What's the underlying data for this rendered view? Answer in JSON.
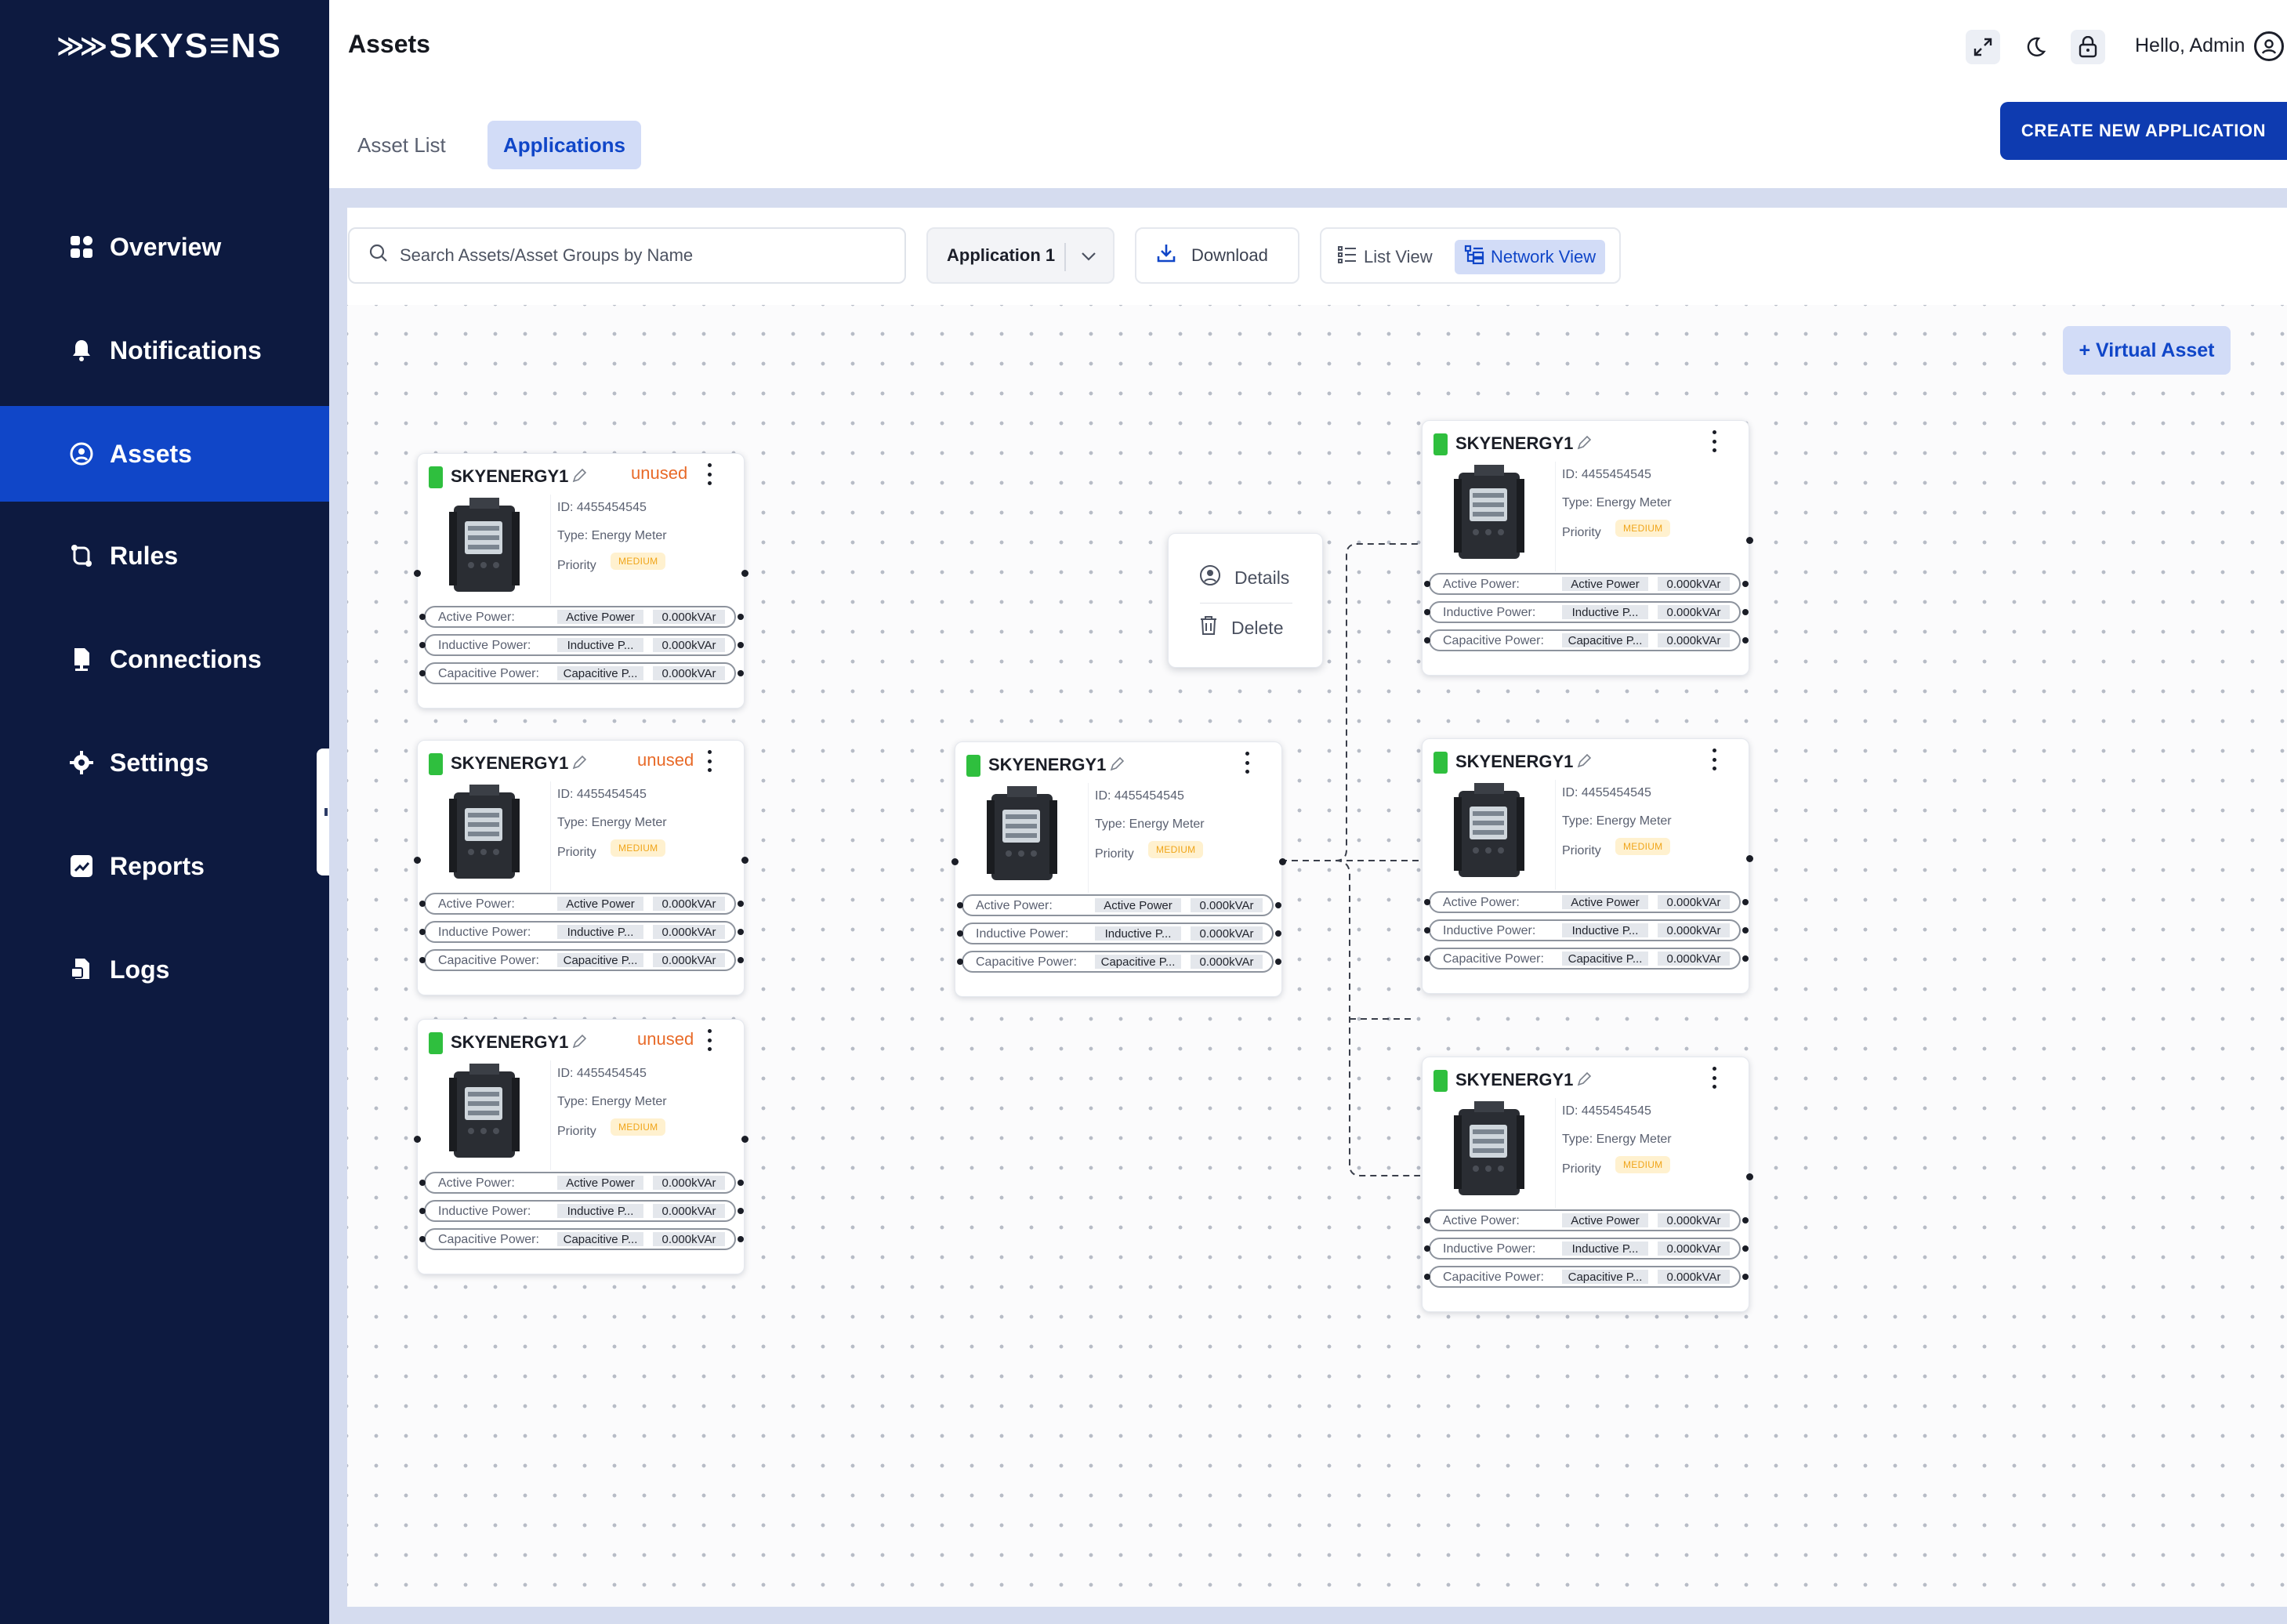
{
  "brand": {
    "name": "SKYS≡NS"
  },
  "sidebar": {
    "items": [
      {
        "label": "Overview"
      },
      {
        "label": "Notifications"
      },
      {
        "label": "Assets"
      },
      {
        "label": "Rules"
      },
      {
        "label": "Connections"
      },
      {
        "label": "Settings"
      },
      {
        "label": "Reports"
      },
      {
        "label": "Logs"
      }
    ],
    "active": "Assets"
  },
  "header": {
    "title": "Assets",
    "greeting": "Hello, Admin"
  },
  "tabs": [
    {
      "label": "Asset List"
    },
    {
      "label": "Applications"
    }
  ],
  "toolbar": {
    "create_label": "CREATE NEW APPLICATION",
    "search_placeholder": "Search Assets/Asset Groups by Name",
    "application_select": "Application 1",
    "download_label": "Download",
    "list_view_label": "List View",
    "network_view_label": "Network View"
  },
  "canvas": {
    "virtual_asset_label": "+ Virtual Asset",
    "context_menu": {
      "details": "Details",
      "delete": "Delete"
    }
  },
  "cards": [
    {
      "name": "SKYENERGY1",
      "unused": "unused",
      "id": "ID: 4455454545",
      "type": "Type: Energy Meter",
      "priority_label": "Priority",
      "priority": "MEDIUM",
      "rows": [
        {
          "label": "Active Power:",
          "chip": "Active Power",
          "value": "0.000kVAr"
        },
        {
          "label": "Inductive Power:",
          "chip": "Inductive P...",
          "value": "0.000kVAr"
        },
        {
          "label": "Capacitive Power:",
          "chip": "Capacitive P...",
          "value": "0.000kVAr"
        }
      ]
    },
    {
      "name": "SKYENERGY1",
      "unused": "unused",
      "id": "ID: 4455454545",
      "type": "Type: Energy Meter",
      "priority_label": "Priority",
      "priority": "MEDIUM",
      "rows": [
        {
          "label": "Active Power:",
          "chip": "Active Power",
          "value": "0.000kVAr"
        },
        {
          "label": "Inductive Power:",
          "chip": "Inductive P...",
          "value": "0.000kVAr"
        },
        {
          "label": "Capacitive Power:",
          "chip": "Capacitive P...",
          "value": "0.000kVAr"
        }
      ]
    },
    {
      "name": "SKYENERGY1",
      "unused": "unused",
      "id": "ID: 4455454545",
      "type": "Type: Energy Meter",
      "priority_label": "Priority",
      "priority": "MEDIUM",
      "rows": [
        {
          "label": "Active Power:",
          "chip": "Active Power",
          "value": "0.000kVAr"
        },
        {
          "label": "Inductive Power:",
          "chip": "Inductive P...",
          "value": "0.000kVAr"
        },
        {
          "label": "Capacitive Power:",
          "chip": "Capacitive P...",
          "value": "0.000kVAr"
        }
      ]
    },
    {
      "name": "SKYENERGY1",
      "unused": "",
      "id": "ID: 4455454545",
      "type": "Type: Energy Meter",
      "priority_label": "Priority",
      "priority": "MEDIUM",
      "rows": [
        {
          "label": "Active Power:",
          "chip": "Active Power",
          "value": "0.000kVAr"
        },
        {
          "label": "Inductive Power:",
          "chip": "Inductive P...",
          "value": "0.000kVAr"
        },
        {
          "label": "Capacitive Power:",
          "chip": "Capacitive P...",
          "value": "0.000kVAr"
        }
      ]
    },
    {
      "name": "SKYENERGY1",
      "unused": "",
      "id": "ID: 4455454545",
      "type": "Type: Energy Meter",
      "priority_label": "Priority",
      "priority": "MEDIUM",
      "rows": [
        {
          "label": "Active Power:",
          "chip": "Active Power",
          "value": "0.000kVAr"
        },
        {
          "label": "Inductive Power:",
          "chip": "Inductive P...",
          "value": "0.000kVAr"
        },
        {
          "label": "Capacitive Power:",
          "chip": "Capacitive P...",
          "value": "0.000kVAr"
        }
      ]
    },
    {
      "name": "SKYENERGY1",
      "unused": "",
      "id": "ID: 4455454545",
      "type": "Type: Energy Meter",
      "priority_label": "Priority",
      "priority": "MEDIUM",
      "rows": [
        {
          "label": "Active Power:",
          "chip": "Active Power",
          "value": "0.000kVAr"
        },
        {
          "label": "Inductive Power:",
          "chip": "Inductive P...",
          "value": "0.000kVAr"
        },
        {
          "label": "Capacitive Power:",
          "chip": "Capacitive P...",
          "value": "0.000kVAr"
        }
      ]
    },
    {
      "name": "SKYENERGY1",
      "unused": "",
      "id": "ID: 4455454545",
      "type": "Type: Energy Meter",
      "priority_label": "Priority",
      "priority": "MEDIUM",
      "rows": [
        {
          "label": "Active Power:",
          "chip": "Active Power",
          "value": "0.000kVAr"
        },
        {
          "label": "Inductive Power:",
          "chip": "Inductive P...",
          "value": "0.000kVAr"
        },
        {
          "label": "Capacitive Power:",
          "chip": "Capacitive P...",
          "value": "0.000kVAr"
        }
      ]
    }
  ],
  "colors": {
    "sidebar_bg": "#0d1a40",
    "accent": "#1046c8",
    "status_green": "#2fbf3e",
    "unused_orange": "#e86a28",
    "priority_amber": "#f0a51a"
  }
}
